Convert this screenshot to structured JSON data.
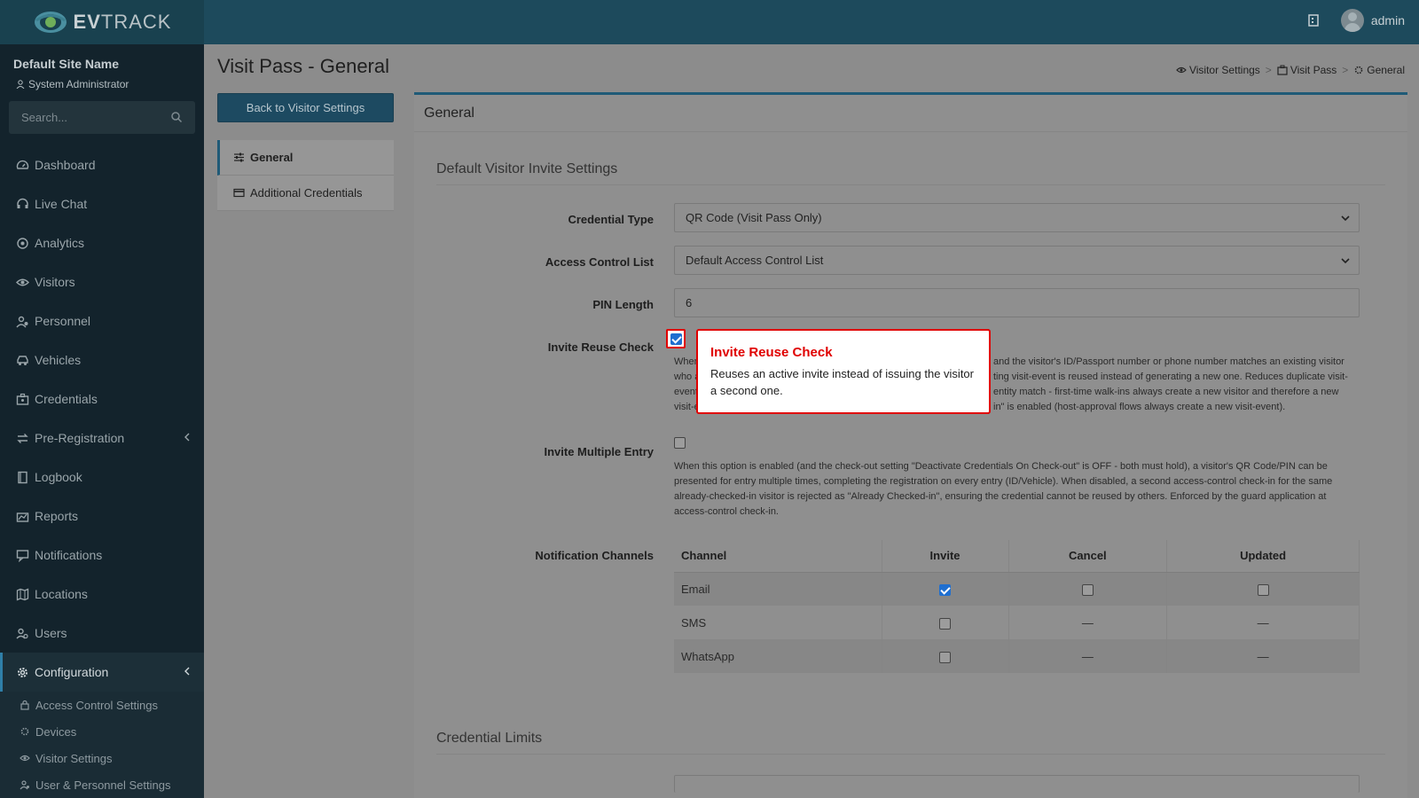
{
  "app": {
    "brand": "EVTRACK",
    "brand_bold": "EV",
    "brand_light": "TRACK"
  },
  "topbar": {
    "user": "admin"
  },
  "sidebar": {
    "site_name": "Default Site Name",
    "role": "System Administrator",
    "search_placeholder": "Search...",
    "items": [
      {
        "label": "Dashboard",
        "icon": "dashboard-icon"
      },
      {
        "label": "Live Chat",
        "icon": "headset-icon"
      },
      {
        "label": "Analytics",
        "icon": "analytics-icon"
      },
      {
        "label": "Visitors",
        "icon": "eye-icon"
      },
      {
        "label": "Personnel",
        "icon": "personnel-icon"
      },
      {
        "label": "Vehicles",
        "icon": "car-icon"
      },
      {
        "label": "Credentials",
        "icon": "credentials-icon"
      },
      {
        "label": "Pre-Registration",
        "icon": "swap-icon"
      },
      {
        "label": "Logbook",
        "icon": "book-icon"
      },
      {
        "label": "Reports",
        "icon": "reports-icon"
      },
      {
        "label": "Notifications",
        "icon": "notifications-icon"
      },
      {
        "label": "Locations",
        "icon": "map-icon"
      },
      {
        "label": "Users",
        "icon": "users-icon"
      },
      {
        "label": "Configuration",
        "icon": "gear-icon"
      }
    ],
    "sub_items": [
      {
        "label": "Access Control Settings",
        "icon": "lock-icon"
      },
      {
        "label": "Devices",
        "icon": "devices-icon"
      },
      {
        "label": "Visitor Settings",
        "icon": "eye-icon"
      },
      {
        "label": "User & Personnel Settings",
        "icon": "user-settings-icon"
      }
    ]
  },
  "page": {
    "title": "Visit Pass - General",
    "breadcrumb": [
      "Visitor Settings",
      "Visit Pass",
      "General"
    ],
    "back_button": "Back to Visitor Settings",
    "side_menu": [
      "General",
      "Additional Credentials"
    ]
  },
  "card": {
    "header": "General",
    "section1": "Default Visitor Invite Settings",
    "credential_type": {
      "label": "Credential Type",
      "value": "QR Code (Visit Pass Only)"
    },
    "access_control_list": {
      "label": "Access Control List",
      "value": "Default Access Control List"
    },
    "pin_length": {
      "label": "PIN Length",
      "value": "6"
    },
    "invite_reuse": {
      "label": "Invite Reuse Check",
      "checked": true,
      "help_lines": [
        "When",
        "who a",
        "event",
        "visit-e"
      ],
      "help_right_lines": [
        "and the visitor's ID/Passport number or phone number matches an existing visitor",
        "ting visit-event is reused instead of generating a new one. Reduces duplicate visit-",
        "entity match - first-time walk-ins always create a new visitor and therefore a new",
        "in\" is enabled (host-approval flows always create a new visit-event)."
      ]
    },
    "invite_multiple": {
      "label": "Invite Multiple Entry",
      "checked": false,
      "help": "When this option is enabled (and the check-out setting \"Deactivate Credentials On Check-out\" is OFF - both must hold), a visitor's QR Code/PIN can be presented for entry multiple times, completing the registration on every entry (ID/Vehicle). When disabled, a second access-control check-in for the same already-checked-in visitor is rejected as \"Already Checked-in\", ensuring the credential cannot be reused by others. Enforced by the guard application at access-control check-in."
    },
    "notification_channels": {
      "label": "Notification Channels",
      "columns": [
        "Channel",
        "Invite",
        "Cancel",
        "Updated"
      ],
      "rows": [
        {
          "channel": "Email",
          "invite": true,
          "cancel": false,
          "updated": false
        },
        {
          "channel": "SMS",
          "invite": false,
          "cancel": "—",
          "updated": "—"
        },
        {
          "channel": "WhatsApp",
          "invite": false,
          "cancel": "—",
          "updated": "—"
        }
      ]
    },
    "section2": "Credential Limits"
  },
  "tooltip": {
    "title": "Invite Reuse Check",
    "body": "Reuses an active invite instead of issuing the visitor a second one."
  },
  "colors": {
    "accent": "#1f5a77",
    "tooltip_border": "#e00000",
    "checkbox": "#1f6fd0"
  }
}
